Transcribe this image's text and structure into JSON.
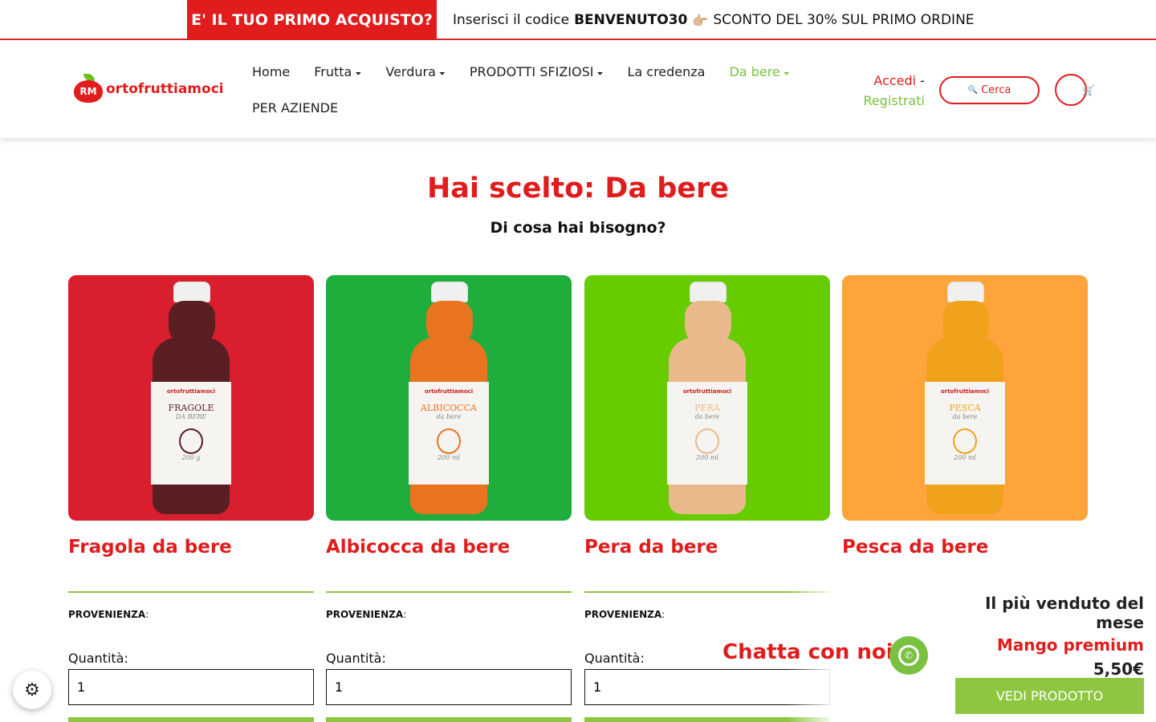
{
  "promo": {
    "badge": "E' IL TUO PRIMO ACQUISTO?",
    "text_before": "Inserisci il codice",
    "code": "BENVENUTO30",
    "hand_icon": "👉🏼",
    "text_after": "SCONTO DEL 30% SUL PRIMO ORDINE"
  },
  "header": {
    "logo_mark": "RM",
    "logo_text": "ortofruttiamoci",
    "nav": [
      {
        "label": "Home"
      },
      {
        "label": "Frutta",
        "caret": "⏷"
      },
      {
        "label": "Verdura",
        "caret": "⏷"
      },
      {
        "label": "PRODOTTI SFIZIOSI",
        "caret": "⏷"
      },
      {
        "label": "La credenza"
      },
      {
        "label": "Da bere",
        "caret": "⏷",
        "active": true
      },
      {
        "label": "PER AZIENDE"
      }
    ],
    "login": "Accedi",
    "separator": "-",
    "register": "Registrati",
    "search_label": "Cerca",
    "search_icon": "🔍",
    "cart_icon": "🛒"
  },
  "page": {
    "title": "Hai scelto: Da bere",
    "subtitle": "Di cosa hai bisogno?"
  },
  "products": [
    {
      "name": "Fragola da bere",
      "origin_label": "PROVENIENZA",
      "origin_suffix": ":",
      "qty_label": "Quantità:",
      "qty": "1",
      "bg": "#d91e2e",
      "liquid": "#5a1f22",
      "label_title": "FRAGOLE",
      "label_sub": "DA BERE",
      "label_extra": "200 g",
      "brand": "ortofruttiamoci"
    },
    {
      "name": "Albicocca da bere",
      "origin_label": "PROVENIENZA",
      "origin_suffix": ":",
      "qty_label": "Quantità:",
      "qty": "1",
      "bg": "#1fae3c",
      "liquid": "#e8741f",
      "label_title": "ALBICOCCA",
      "label_sub": "da bere",
      "label_extra": "200 ml",
      "brand": "ortofruttiamoci"
    },
    {
      "name": "Pera da bere",
      "origin_label": "PROVENIENZA",
      "origin_suffix": ":",
      "qty_label": "Quantità:",
      "qty": "1",
      "bg": "#66cc00",
      "liquid": "#e9b98c",
      "label_title": "PERA",
      "label_sub": "da bere",
      "label_extra": "200 ml",
      "brand": "ortofruttiamoci"
    },
    {
      "name": "Pesca da bere",
      "bg": "#ffa43a",
      "liquid": "#f1a21c",
      "label_title": "PESCA",
      "label_sub": "da bere",
      "label_extra": "200 ml",
      "brand": "ortofruttiamoci"
    }
  ],
  "chat": {
    "label": "Chatta con noi",
    "icon": "whatsapp-icon"
  },
  "best_seller": {
    "title": "Il più venduto del mese",
    "product": "Mango premium",
    "price": "5,50€",
    "button": "VEDI PRODOTTO"
  },
  "settings_icon": "⚙"
}
